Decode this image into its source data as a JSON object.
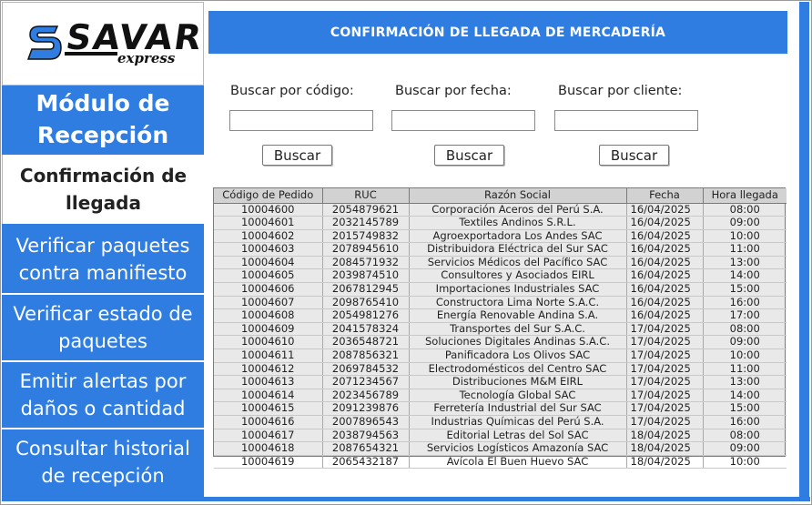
{
  "logo": {
    "brand": "SAVAR",
    "tagline": "express"
  },
  "sidebar": {
    "module_title": "Módulo de Recepción",
    "items": [
      {
        "label": "Confirmación de llegada",
        "active": true
      },
      {
        "label": "Verificar paquetes contra manifiesto",
        "active": false
      },
      {
        "label": "Verificar estado de paquetes",
        "active": false
      },
      {
        "label": "Emitir alertas por daños o cantidad",
        "active": false
      },
      {
        "label": "Consultar historial de recepción",
        "active": false
      }
    ]
  },
  "header": {
    "title": "CONFIRMACIÓN DE LLEGADA DE MERCADERÍA"
  },
  "search": {
    "by_code": {
      "label": "Buscar por código:",
      "value": "",
      "button": "Buscar"
    },
    "by_date": {
      "label": "Buscar por fecha:",
      "value": "",
      "button": "Buscar"
    },
    "by_client": {
      "label": "Buscar por cliente:",
      "value": "",
      "button": "Buscar"
    }
  },
  "table": {
    "columns": [
      "Código de Pedido",
      "RUC",
      "Razón Social",
      "Fecha",
      "Hora llegada"
    ],
    "rows": [
      [
        "10004600",
        "2054879621",
        "Corporación Aceros del Perú S.A.",
        "16/04/2025",
        "08:00"
      ],
      [
        "10004601",
        "2032145789",
        "Textiles Andinos S.R.L.",
        "16/04/2025",
        "09:00"
      ],
      [
        "10004602",
        "2015749832",
        "Agroexportadora Los Andes SAC",
        "16/04/2025",
        "10:00"
      ],
      [
        "10004603",
        "2078945610",
        "Distribuidora Eléctrica del Sur SAC",
        "16/04/2025",
        "11:00"
      ],
      [
        "10004604",
        "2084571932",
        "Servicios Médicos del Pacífico SAC",
        "16/04/2025",
        "13:00"
      ],
      [
        "10004605",
        "2039874510",
        "Consultores y Asociados EIRL",
        "16/04/2025",
        "14:00"
      ],
      [
        "10004606",
        "2067812945",
        "Importaciones Industriales SAC",
        "16/04/2025",
        "15:00"
      ],
      [
        "10004607",
        "2098765410",
        "Constructora Lima Norte S.A.C.",
        "16/04/2025",
        "16:00"
      ],
      [
        "10004608",
        "2054981276",
        "Energía Renovable Andina S.A.",
        "16/04/2025",
        "17:00"
      ],
      [
        "10004609",
        "2041578324",
        "Transportes del Sur S.A.C.",
        "17/04/2025",
        "08:00"
      ],
      [
        "10004610",
        "2036548721",
        "Soluciones Digitales Andinas S.A.C.",
        "17/04/2025",
        "09:00"
      ],
      [
        "10004611",
        "2087856321",
        "Panificadora Los Olivos SAC",
        "17/04/2025",
        "10:00"
      ],
      [
        "10004612",
        "2069784532",
        "Electrodomésticos del Centro SAC",
        "17/04/2025",
        "11:00"
      ],
      [
        "10004613",
        "2071234567",
        "Distribuciones M&M EIRL",
        "17/04/2025",
        "13:00"
      ],
      [
        "10004614",
        "2023456789",
        "Tecnología Global SAC",
        "17/04/2025",
        "14:00"
      ],
      [
        "10004615",
        "2091239876",
        "Ferretería Industrial del Sur SAC",
        "17/04/2025",
        "15:00"
      ],
      [
        "10004616",
        "2007896543",
        "Industrias Químicas del Perú S.A.",
        "17/04/2025",
        "16:00"
      ],
      [
        "10004617",
        "2038794563",
        "Editorial Letras del Sol SAC",
        "18/04/2025",
        "08:00"
      ],
      [
        "10004618",
        "2087654321",
        "Servicios Logísticos Amazonía SAC",
        "18/04/2025",
        "09:00"
      ],
      [
        "10004619",
        "2065432187",
        "Avícola El Buen Huevo SAC",
        "18/04/2025",
        "10:00"
      ]
    ]
  },
  "colors": {
    "accent": "#2f7de1",
    "header_row": "#d2d2d2",
    "table_body": "#e9e9e9"
  }
}
